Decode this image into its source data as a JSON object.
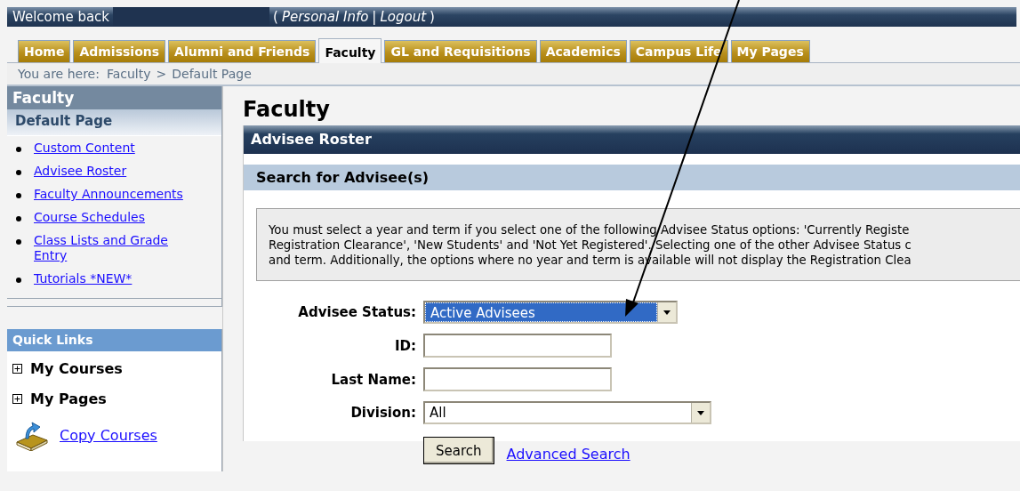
{
  "header": {
    "greeting": "Welcome back",
    "user_name_redacted": true,
    "links_open": "(",
    "links": [
      {
        "label": "Personal Info"
      },
      {
        "label": "Logout"
      }
    ],
    "links_separator": "|",
    "links_close": ")"
  },
  "tabs": [
    {
      "label": "Home",
      "selected": false
    },
    {
      "label": "Admissions",
      "selected": false
    },
    {
      "label": "Alumni and Friends",
      "selected": false
    },
    {
      "label": "Faculty",
      "selected": true
    },
    {
      "label": "GL and Requisitions",
      "selected": false
    },
    {
      "label": "Academics",
      "selected": false
    },
    {
      "label": "Campus Life",
      "selected": false
    },
    {
      "label": "My Pages",
      "selected": false
    }
  ],
  "breadcrumb": {
    "prefix": "You are here:",
    "items": [
      "Faculty",
      "Default Page"
    ],
    "separator": ">"
  },
  "sidebar": {
    "title": "Faculty",
    "subtitle": "Default Page",
    "items": [
      {
        "label": "Custom Content"
      },
      {
        "label": "Advisee Roster"
      },
      {
        "label": "Faculty Announcements"
      },
      {
        "label": "Course Schedules"
      },
      {
        "label": "Class Lists and Grade Entry"
      },
      {
        "label": "Tutorials *NEW*"
      }
    ]
  },
  "quick_links": {
    "title": "Quick Links",
    "items": [
      {
        "kind": "expander",
        "label": "My Courses",
        "expanded": false
      },
      {
        "kind": "expander",
        "label": "My Pages",
        "expanded": false
      },
      {
        "kind": "link",
        "label": "Copy Courses"
      }
    ]
  },
  "main": {
    "title": "Faculty",
    "section_title": "Advisee Roster",
    "subsection_title": "Search for Advisee(s)",
    "notice_lines": [
      "You must select a year and term if you select one of the following Advisee Status options: 'Currently Registe",
      "Registration Clearance', 'New Students' and 'Not Yet Registered'. Selecting one of the other Advisee Status c",
      "and term. Additionally, the options where no year and term is available will not display the Registration Clea"
    ],
    "fields": [
      {
        "kind": "select",
        "label": "Advisee Status:",
        "value": "Active Advisees",
        "highlighted": true
      },
      {
        "kind": "text",
        "label": "ID:"
      },
      {
        "kind": "text",
        "label": "Last Name:"
      },
      {
        "kind": "select",
        "label": "Division:",
        "value": "All",
        "highlighted": false
      }
    ],
    "search_button": "Search",
    "advanced_search_link": "Advanced Search"
  },
  "annotation": {
    "kind": "arrow"
  }
}
